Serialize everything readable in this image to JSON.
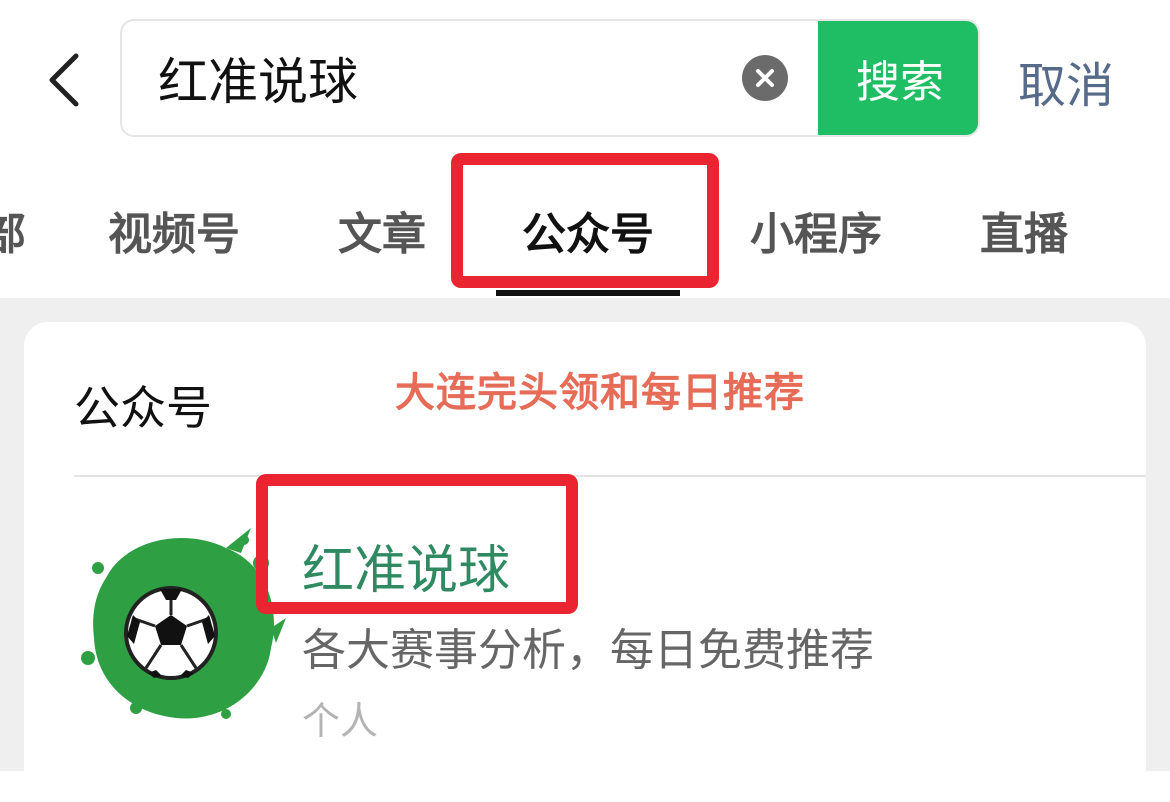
{
  "header": {
    "search_value": "红准说球",
    "search_button": "搜索",
    "cancel_label": "取消"
  },
  "tabs": [
    {
      "label": "部"
    },
    {
      "label": "视频号"
    },
    {
      "label": "文章"
    },
    {
      "label": "公众号",
      "active": true
    },
    {
      "label": "小程序"
    },
    {
      "label": "直播"
    }
  ],
  "section": {
    "title": "公众号"
  },
  "watermark": "大连完头领和每日推荐",
  "result": {
    "name": "红准说球",
    "description": "各大赛事分析，每日免费推荐",
    "type": "个人"
  },
  "colors": {
    "accent_green": "#1fbe64",
    "highlight_red": "#ea2430",
    "name_green": "#2f8a62",
    "cancel_blue": "#566a8a"
  }
}
